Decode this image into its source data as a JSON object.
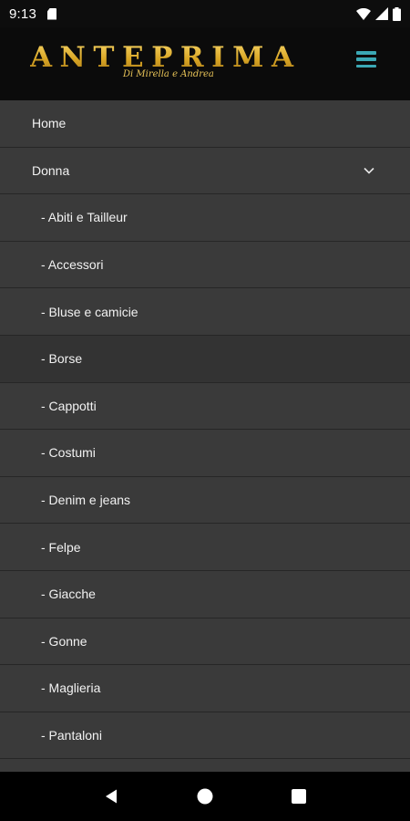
{
  "status_bar": {
    "time": "9:13"
  },
  "header": {
    "logo_text": "ANTEPRIMA",
    "logo_subtitle": "Di Mirella e Andrea",
    "accent_color": "#3ba8b5",
    "logo_color": "#d9aa25"
  },
  "menu": {
    "items": [
      {
        "label": "Home",
        "level": "top"
      },
      {
        "label": "Donna",
        "level": "top",
        "expanded": true
      },
      {
        "label": "- Abiti e Tailleur",
        "level": "sub"
      },
      {
        "label": "- Accessori",
        "level": "sub"
      },
      {
        "label": "- Bluse e camicie",
        "level": "sub"
      },
      {
        "label": "- Borse",
        "level": "sub",
        "highlighted": true
      },
      {
        "label": "- Cappotti",
        "level": "sub"
      },
      {
        "label": "- Costumi",
        "level": "sub"
      },
      {
        "label": "- Denim e jeans",
        "level": "sub"
      },
      {
        "label": "- Felpe",
        "level": "sub"
      },
      {
        "label": "- Giacche",
        "level": "sub"
      },
      {
        "label": "- Gonne",
        "level": "sub"
      },
      {
        "label": "- Maglieria",
        "level": "sub"
      },
      {
        "label": "- Pantaloni",
        "level": "sub"
      }
    ]
  },
  "icons": {
    "menu": "hamburger-icon",
    "expand": "chevron-down-icon",
    "back": "back-triangle-icon",
    "home": "home-circle-icon",
    "recents": "recents-square-icon"
  }
}
